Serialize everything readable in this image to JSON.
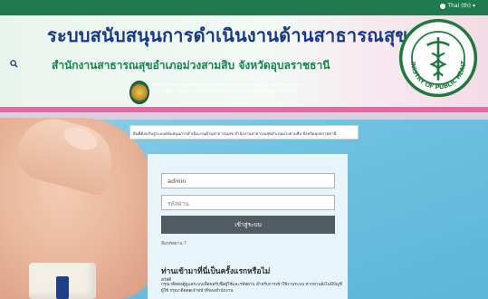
{
  "topbar": {
    "language": "Thai (th)"
  },
  "header": {
    "title": "ระบบสนับสนุนการดำเนินงานด้านสาธารณสุข",
    "subtitle": "สำนักงานสาธารณสุขอำเภอม่วงสามสิบ จังหวัดอุบลราชธานี",
    "developer_text": "เป็นส่วนหนึ่งของการศึกษาตามหลักสูตรวิทยาศาสตรมหาบัณฑิต สาขาวิชาสารสนเทศศาสตร์เพื่อการพัฒนาการศึกษา บัณฑิตวิทยาลัย มหาวิทยาลัยราชภัฏอุบลราชธานี",
    "ministry_logo_text": "MINISTRY OF PUBLIC HEALTH"
  },
  "notice": "ยินดีต้อนรับสู่ระบบสนับสนุนการดำเนินงานด้านสาธารณสุข สำนักงานสาธารณสุขอำเภอม่วงสามสิบ จังหวัดอุบลราชธานี",
  "login": {
    "username_value": "admin",
    "password_placeholder": "รหัสผ่าน",
    "submit_label": "เข้าสู่ระบบ",
    "forgot_label": "ลืมรหัสผ่าน ?",
    "new_user_title": "ท่านเข้ามาที่นี่เป็นครั้งแรกหรือไม่",
    "new_user_label": "สวัสดี",
    "new_user_desc": "กรุณาติดต่อผู้ดูแลระบบเพื่อขอรับชื่อผู้ใช้และรหัสผ่าน สำหรับการเข้าใช้งานระบบ หากท่านยังไม่มีบัญชีผู้ใช้ กรุณาติดต่อเจ้าหน้าที่ของสำนักงาน"
  },
  "colors": {
    "topbar": "#1f7a50",
    "title": "#163a8a",
    "subtitle": "#15864a",
    "button": "#535b62"
  }
}
